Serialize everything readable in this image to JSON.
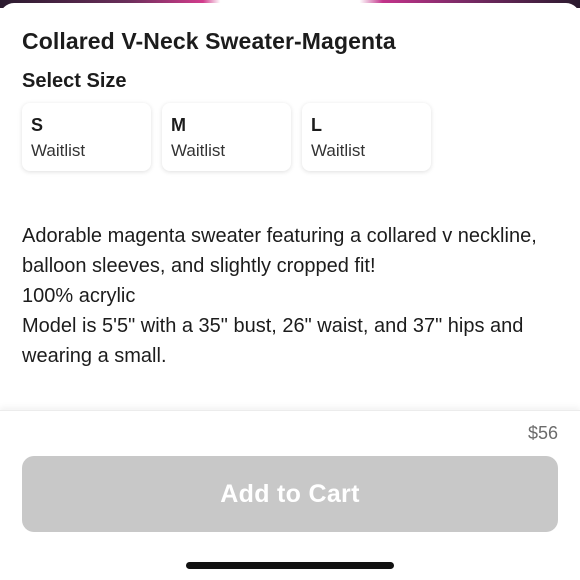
{
  "product": {
    "title": "Collared V-Neck Sweater-Magenta",
    "price": "$56"
  },
  "size_selector": {
    "heading": "Select Size",
    "options": [
      {
        "size": "S",
        "status": "Waitlist"
      },
      {
        "size": "M",
        "status": "Waitlist"
      },
      {
        "size": "L",
        "status": "Waitlist"
      }
    ]
  },
  "description": {
    "lines": [
      "Adorable magenta sweater featuring a collared v neckline, balloon sleeves, and slightly cropped fit!",
      "100% acrylic",
      "Model is 5'5\" with a 35\" bust, 26\" waist, and 37\" hips and wearing a small."
    ]
  },
  "actions": {
    "add_to_cart_label": "Add to Cart",
    "add_to_cart_enabled": false
  },
  "colors": {
    "button_disabled": "#c8c8c8",
    "text_primary": "#1c1c1c",
    "price_text": "#6b6b6b"
  }
}
